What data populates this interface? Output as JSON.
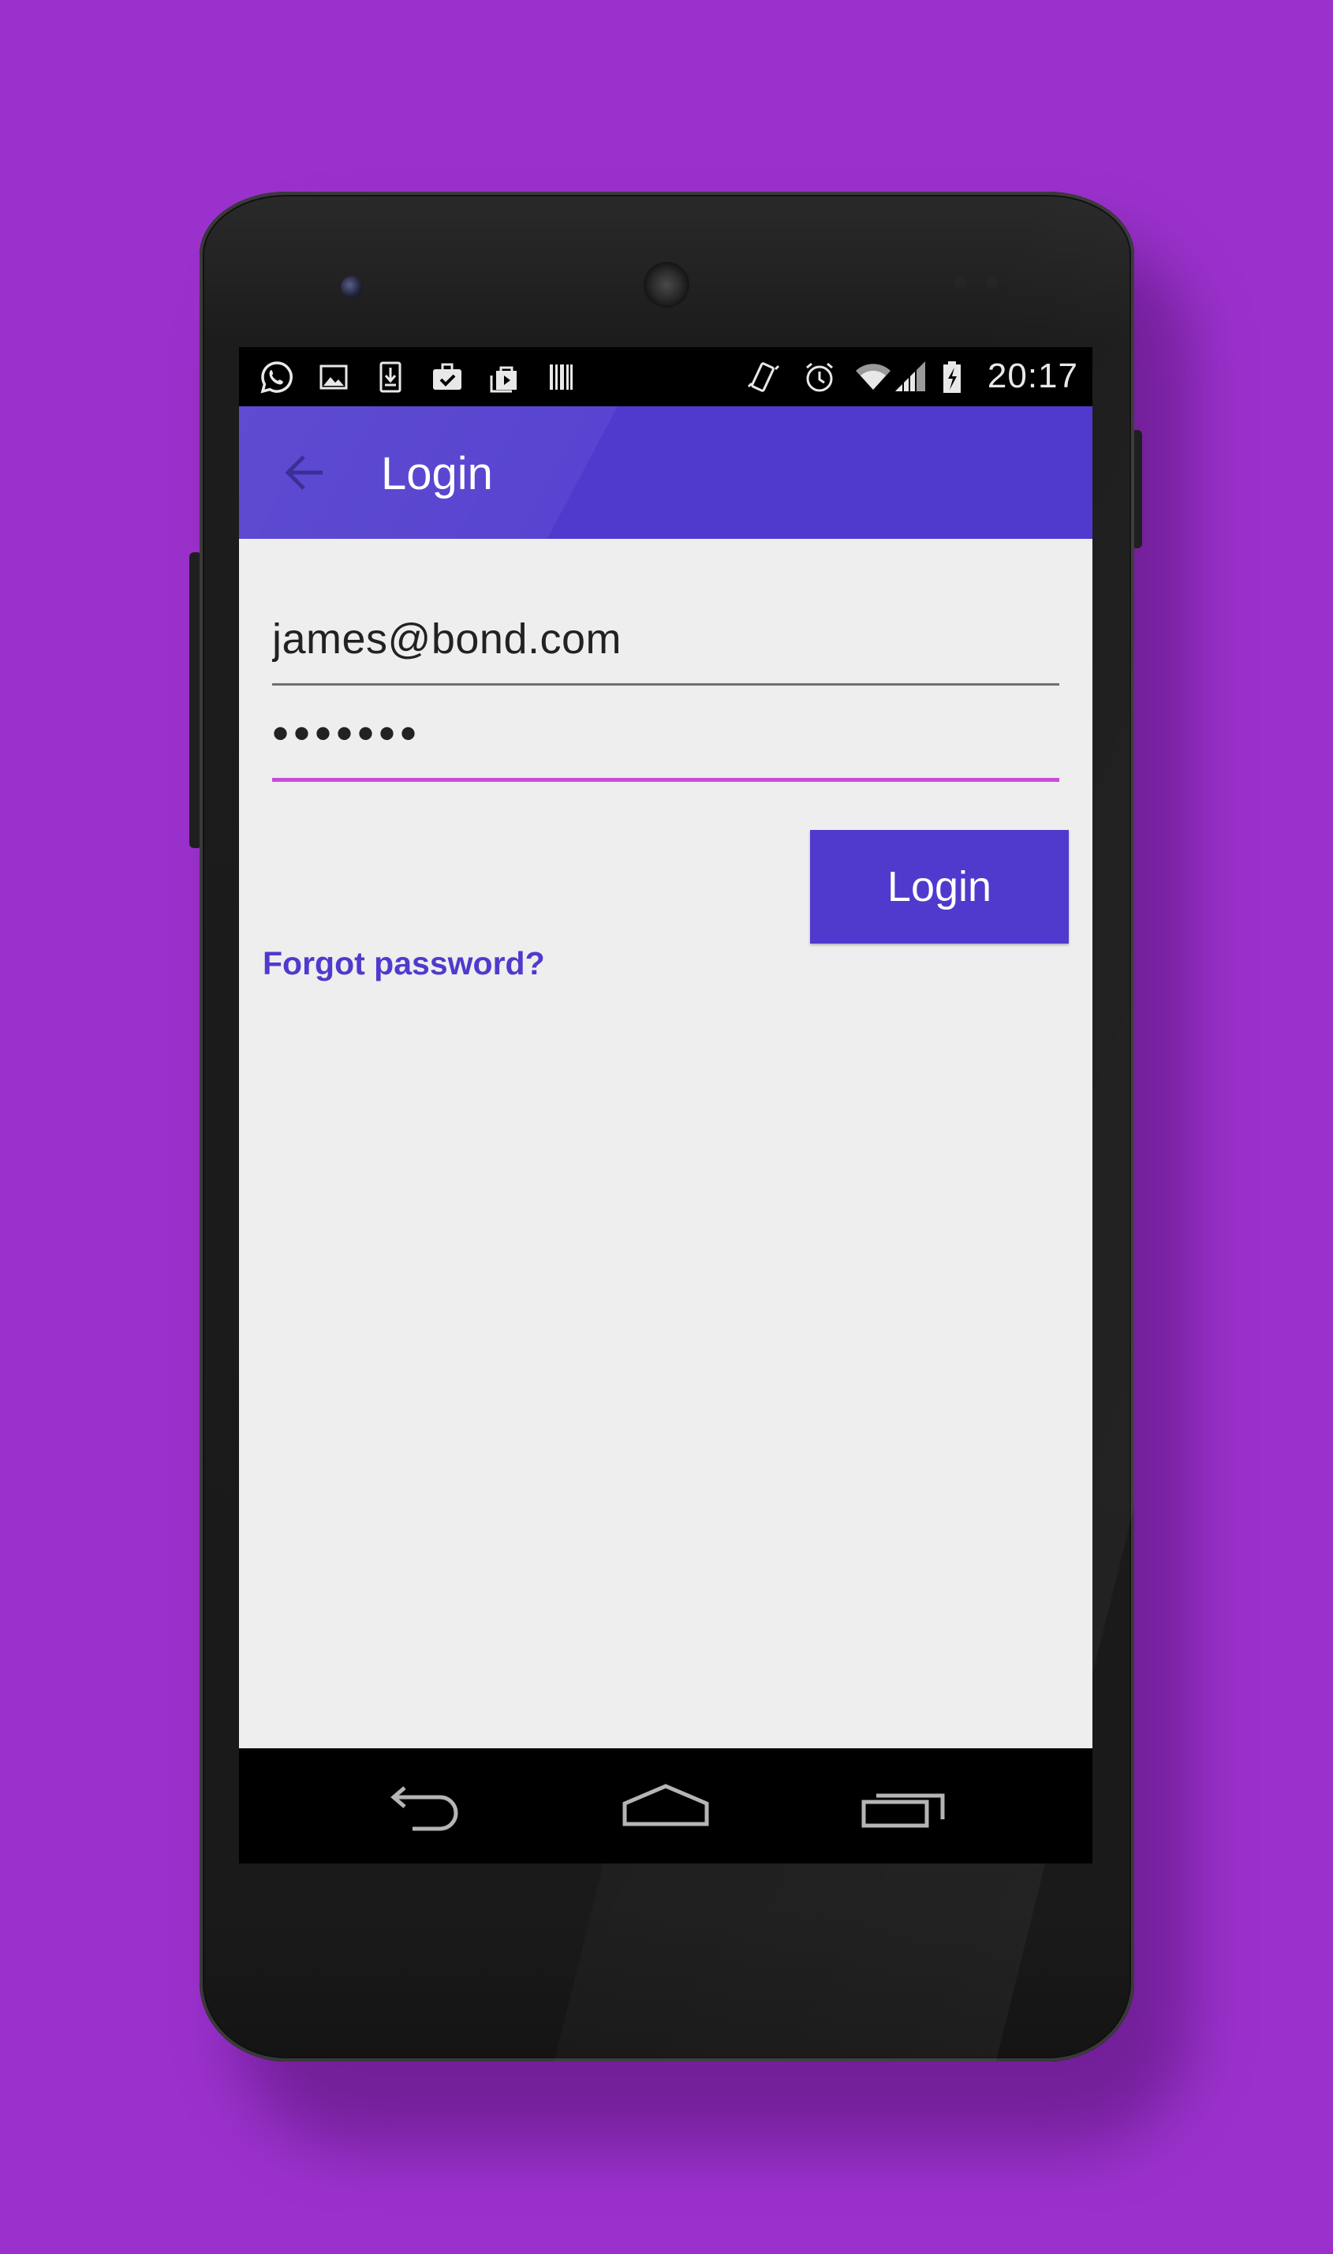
{
  "app": {
    "title": "Login"
  },
  "status_bar": {
    "time": "20:17",
    "notification_icons": [
      "whatsapp-icon",
      "image-icon",
      "download-icon",
      "briefcase-check-icon",
      "play-store-icon",
      "barcode-icon"
    ],
    "system_icons": [
      "vibrate-icon",
      "alarm-icon",
      "wifi-icon",
      "signal-icon",
      "battery-charging-icon"
    ]
  },
  "login_form": {
    "email_value": "james@bond.com",
    "password_value": "•••••••",
    "submit_label": "Login",
    "forgot_label": "Forgot password?"
  },
  "nav_bar": {
    "buttons": [
      "back-icon",
      "home-icon",
      "recents-icon"
    ]
  },
  "colors": {
    "background": "#9b31cc",
    "primary": "#4f3acd",
    "accent": "#c94bd9",
    "screen_background": "#eeeeee"
  }
}
